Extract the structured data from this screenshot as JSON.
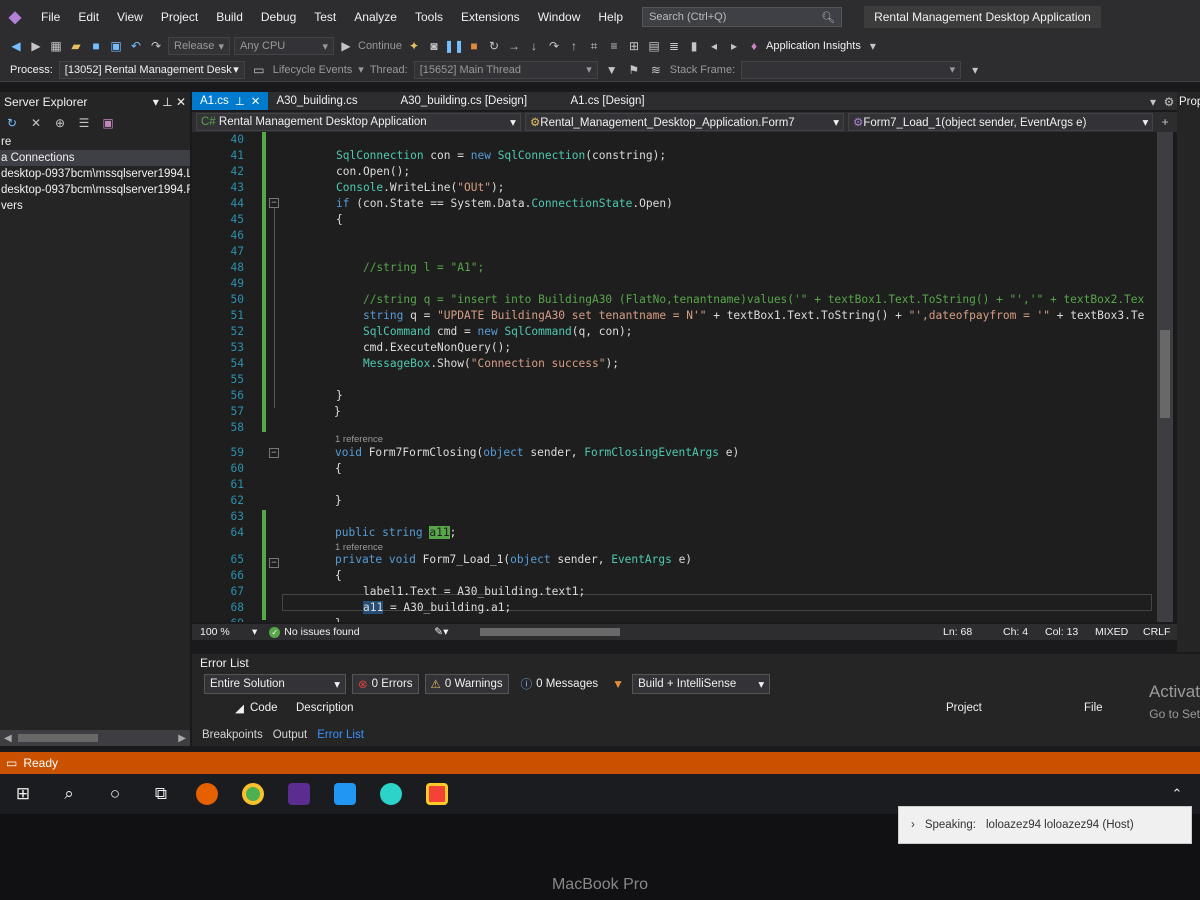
{
  "menubar": {
    "items": [
      "File",
      "Edit",
      "View",
      "Project",
      "Build",
      "Debug",
      "Test",
      "Analyze",
      "Tools",
      "Extensions",
      "Window",
      "Help"
    ],
    "search_placeholder": "Search (Ctrl+Q)",
    "app_title": "Rental Management Desktop Application"
  },
  "toolbar": {
    "config": "Release",
    "platform": "Any CPU",
    "continue_label": "Continue",
    "app_insights": "Application Insights"
  },
  "debug_toolbar": {
    "process_label": "Process:",
    "process_value": "[13052] Rental Management Desk",
    "lifecycle_label": "Lifecycle Events",
    "thread_label": "Thread:",
    "thread_value": "[15652] Main Thread",
    "stack_frame_label": "Stack Frame:"
  },
  "server_explorer": {
    "title": "Server Explorer",
    "items": [
      "re",
      "a Connections",
      "desktop-0937bcm\\mssqlserver1994.L",
      "desktop-0937bcm\\mssqlserver1994.R",
      "vers"
    ]
  },
  "tabs": [
    "A1.cs",
    "A30_building.cs",
    "A30_building.cs [Design]",
    "A1.cs [Design]"
  ],
  "navbar": {
    "project": "Rental Management Desktop Application",
    "class": "Rental_Management_Desktop_Application.Form7",
    "member": "Form7_Load_1(object sender, EventArgs e)"
  },
  "editor": {
    "codelens": "1 reference"
  },
  "status_editor": {
    "zoom": "100 %",
    "issues": "No issues found",
    "ln": "Ln: 68",
    "ch": "Ch: 4",
    "col": "Col: 13",
    "tabs": "MIXED",
    "eol": "CRLF"
  },
  "error_list": {
    "title": "Error List",
    "scope": "Entire Solution",
    "errors": "0 Errors",
    "warnings": "0 Warnings",
    "messages": "0 Messages",
    "build_filter": "Build + IntelliSense",
    "col_code": "Code",
    "col_description": "Description",
    "col_project": "Project",
    "col_file": "File",
    "activate": "Activat",
    "activate2": "Go to Set"
  },
  "tool_tabs": [
    "Breakpoints",
    "Output",
    "Error List"
  ],
  "status_main": {
    "text": "Ready"
  },
  "notification": {
    "label": "Speaking:",
    "who": "loloazez94 loloazez94 (Host)"
  },
  "bezel": {
    "label": "MacBook Pro"
  },
  "right_panel": {
    "title": "Prop"
  },
  "colors": {
    "accent": "#007acc",
    "status": "#ca5100",
    "keyword": "#569cd6",
    "type": "#4ec9b0",
    "string": "#d69d85",
    "comment": "#57a64a"
  }
}
